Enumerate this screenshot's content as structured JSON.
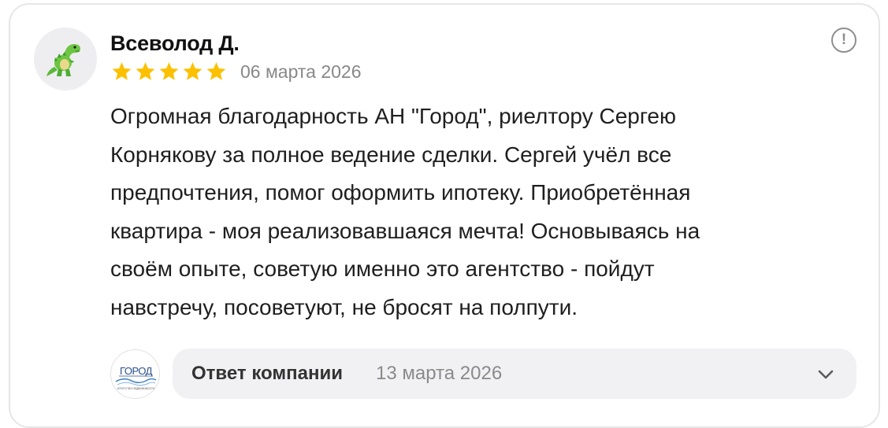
{
  "review": {
    "author": "Всеволод Д.",
    "rating": 5,
    "max_rating": 5,
    "date": "06 марта 2026",
    "text": "Огромная благодарность АН \"Город\", риелтору Сергею\nКорнякову за полное ведение сделки. Сергей учёл все\nпредпочтения, помог оформить ипотеку. Приобретённая\nквартира - моя реализовавшаяся мечта! Основываясь на\nсвоём опыте, советую именно это агентство - пойдут\nнавстречу, посоветуют, не бросят на полпути.",
    "report_icon": "!"
  },
  "reply": {
    "label": "Ответ компании",
    "date": "13 марта 2026"
  },
  "company": {
    "logo_text": "ГОРОД",
    "logo_subtext": "АГЕНТСТВО НЕДВИЖИМОСТИ"
  },
  "colors": {
    "star": "#fbc100",
    "muted": "#888888",
    "reply_bg": "#f1f1f3"
  },
  "icons": {
    "avatar": "dinosaur-icon",
    "report": "report-icon",
    "star": "star-icon",
    "expand": "chevron-down-icon"
  }
}
